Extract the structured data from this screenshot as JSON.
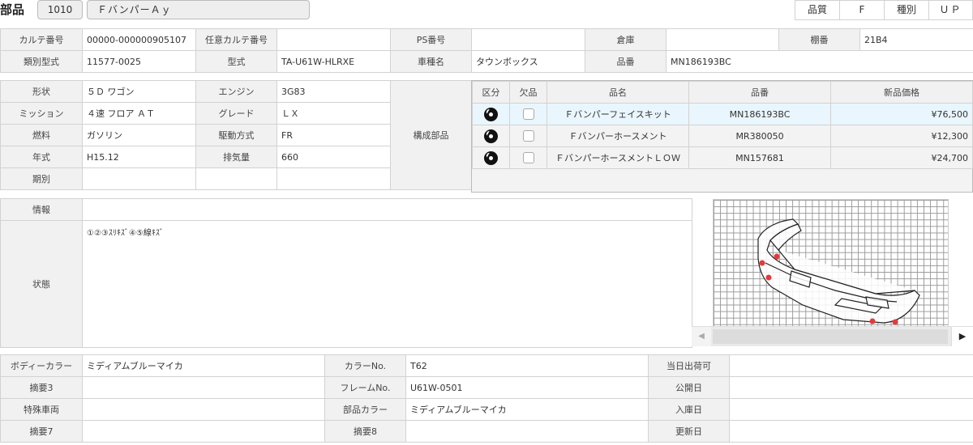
{
  "header": {
    "title": "部品",
    "code": "1010",
    "part_name": "ＦバンパーＡｙ",
    "quality_label": "品質",
    "quality_value": "F",
    "kind_label": "種別",
    "kind_value": "ＵＰ"
  },
  "top_info": {
    "karte_no_label": "カルテ番号",
    "karte_no": "00000-000000905107",
    "nini_karte_label": "任意カルテ番号",
    "nini_karte": "",
    "ps_label": "PS番号",
    "ps": "",
    "warehouse_label": "倉庫",
    "warehouse": "",
    "shelf_label": "棚番",
    "shelf": "21B4",
    "type_spec_label": "類別型式",
    "type_spec": "11577-0025",
    "model_label": "型式",
    "model": "TA-U61W-HLRXE",
    "car_name_label": "車種名",
    "car_name": "タウンボックス",
    "part_no_label": "品番",
    "part_no": "MN186193BC"
  },
  "vehicle": {
    "shape_label": "形状",
    "shape": "５Ｄ ワゴン",
    "engine_label": "エンジン",
    "engine": "3G83",
    "mission_label": "ミッション",
    "mission": "４速 フロア ＡＴ",
    "grade_label": "グレード",
    "grade": "ＬＸ",
    "fuel_label": "燃料",
    "fuel": "ガソリン",
    "drive_label": "駆動方式",
    "drive": "FR",
    "year_label": "年式",
    "year": "H15.12",
    "displacement_label": "排気量",
    "displacement": "660",
    "period_label": "期別",
    "period": "",
    "components_label": "構成部品"
  },
  "components": {
    "headers": [
      "区分",
      "欠品",
      "品名",
      "品番",
      "新品価格"
    ],
    "rows": [
      {
        "name": "Ｆバンパーフェイスキット",
        "part_no": "MN186193BC",
        "price": "¥76,500"
      },
      {
        "name": "Ｆバンパーホースメント",
        "part_no": "MR380050",
        "price": "¥12,300"
      },
      {
        "name": "ＦバンパーホースメントＬＯＷ",
        "part_no": "MN157681",
        "price": "¥24,700"
      }
    ]
  },
  "info": {
    "info_label": "情報",
    "info": "",
    "condition_label": "状態",
    "condition": "①②③ｽﾘｷｽﾞ④⑤線ｷｽﾞ"
  },
  "bottom": {
    "body_color_label": "ボディーカラー",
    "body_color": "ミディアムブルーマイカ",
    "color_no_label": "カラーNo.",
    "color_no": "T62",
    "same_day_label": "当日出荷可",
    "same_day": "",
    "summary3_label": "摘要3",
    "summary3": "",
    "frame_label": "フレームNo.",
    "frame": "U61W-0501",
    "published_label": "公開日",
    "published": "",
    "special_label": "特殊車両",
    "special": "",
    "part_color_label": "部品カラー",
    "part_color": "ミディアムブルーマイカ",
    "stock_date_label": "入庫日",
    "stock_date": "",
    "summary7_label": "摘要7",
    "summary7": "",
    "summary8_label": "摘要8",
    "summary8": "",
    "updated_label": "更新日",
    "updated": ""
  },
  "diagram": {
    "markers": [
      "1",
      "2",
      "3",
      "4",
      "5"
    ],
    "marker_color": "#e23b3b"
  },
  "icons": {
    "category": "disc-icon",
    "missing": "checkbox-icon",
    "scroll_left": "chevron-left-icon",
    "scroll_right": "chevron-right-icon"
  }
}
